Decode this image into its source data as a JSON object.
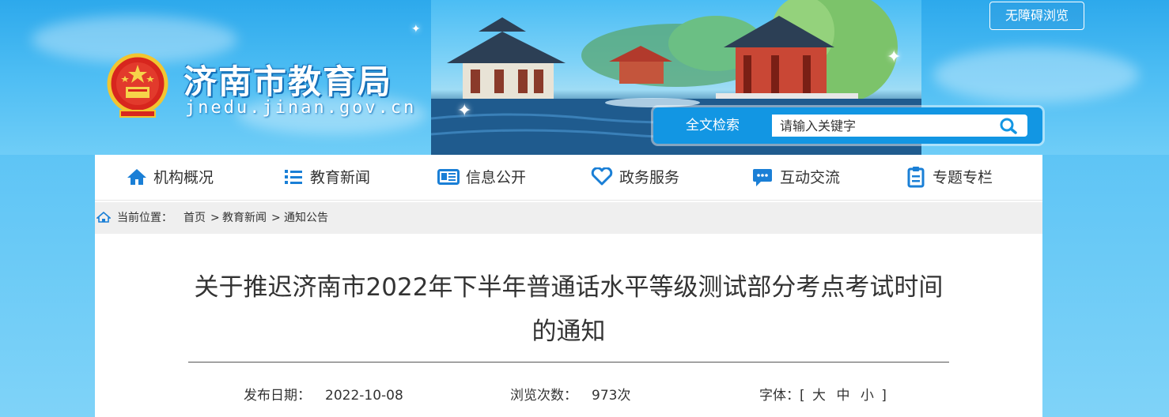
{
  "header": {
    "site_name": "济南市教育局",
    "site_domain": "jnedu.jinan.gov.cn",
    "accessibility_label": "无障碍浏览"
  },
  "search": {
    "label": "全文检索",
    "placeholder": "请输入关键字",
    "button_icon": "search-icon"
  },
  "nav": {
    "items": [
      {
        "label": "机构概况",
        "icon": "home-icon"
      },
      {
        "label": "教育新闻",
        "icon": "list-icon"
      },
      {
        "label": "信息公开",
        "icon": "newspaper-icon"
      },
      {
        "label": "政务服务",
        "icon": "heart-icon"
      },
      {
        "label": "互动交流",
        "icon": "chat-icon"
      },
      {
        "label": "专题专栏",
        "icon": "clipboard-icon"
      }
    ]
  },
  "breadcrumb": {
    "prefix": "当前位置：",
    "items": [
      "首页",
      "教育新闻",
      "通知公告"
    ],
    "separator": ">"
  },
  "article": {
    "title_line1": "关于推迟济南市2022年下半年普通话水平等级测试部分考点考试时间",
    "title_line2": "的通知",
    "publish_label": "发布日期：",
    "publish_date": "2022-10-08",
    "views_label": "浏览次数：",
    "views_value": "973次",
    "font_label": "字体：[",
    "font_large": "大",
    "font_medium": "中",
    "font_small": "小",
    "font_close": "]"
  },
  "colors": {
    "nav_icon": "#1a7fd6",
    "search_bg": "#1296e3",
    "accent": "#2da9ec"
  }
}
